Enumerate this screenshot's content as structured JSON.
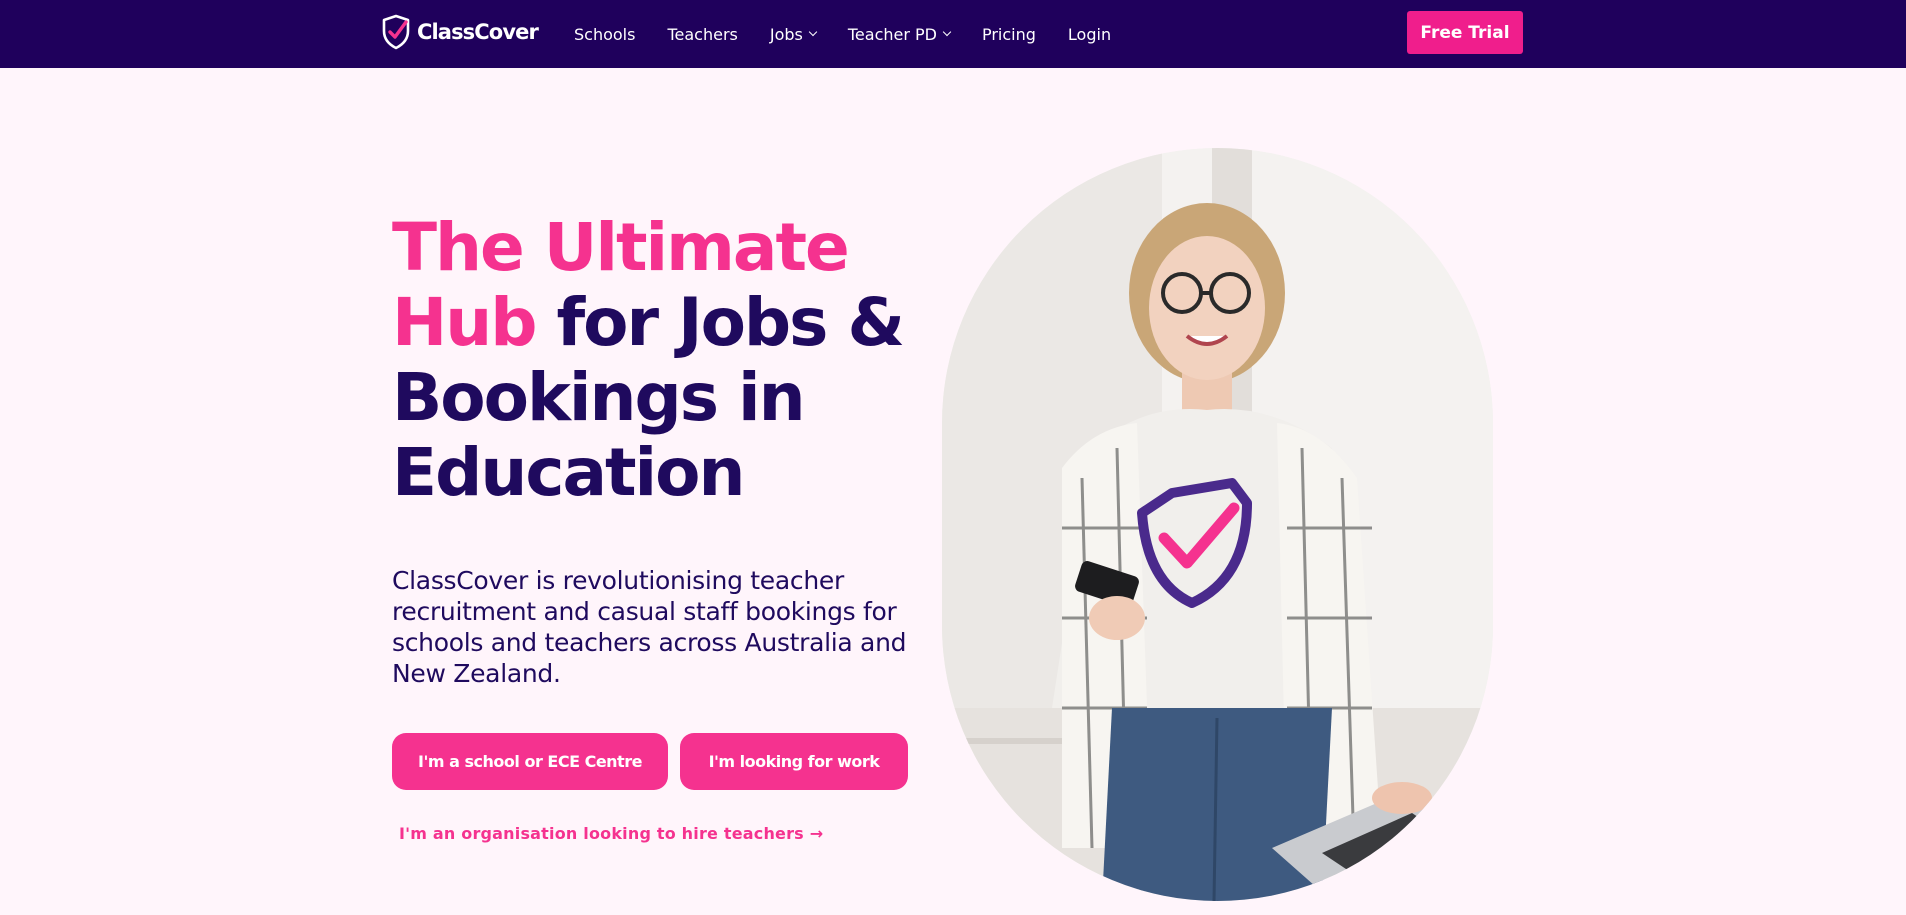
{
  "nav": {
    "brand": "ClassCover",
    "logo_icon": "shield-check-icon",
    "items": [
      {
        "label": "Schools",
        "has_dropdown": false
      },
      {
        "label": "Teachers",
        "has_dropdown": false
      },
      {
        "label": "Jobs",
        "has_dropdown": true
      },
      {
        "label": "Teacher PD",
        "has_dropdown": true
      },
      {
        "label": "Pricing",
        "has_dropdown": false
      },
      {
        "label": "Login",
        "has_dropdown": false
      }
    ],
    "cta_label": "Free Trial"
  },
  "hero": {
    "headline_highlight": "The Ultimate Hub",
    "headline_rest": "for Jobs & Bookings in Education",
    "intro": "ClassCover is revolutionising teacher recruitment and casual staff bookings for schools and teachers across Australia and New Zealand.",
    "btn_school": "I'm a school or ECE Centre",
    "btn_work": "I'm looking for work",
    "org_link": "I'm an organisation looking to hire teachers",
    "org_link_icon": "arrow-right-icon"
  },
  "colors": {
    "nav_bg": "#1f005c",
    "accent": "#f5328f",
    "cta": "#f01e8c",
    "text_dark": "#1f0a5e",
    "page_bg": "#fff5fb"
  }
}
